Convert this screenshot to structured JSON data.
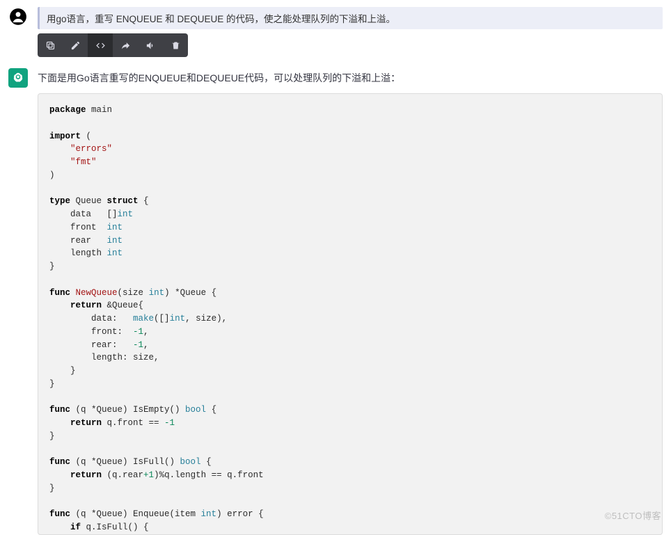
{
  "user": {
    "text": "用go语言，重写 ENQUEUE 和 DEQUEUE 的代码，使之能处理队列的下溢和上溢。"
  },
  "toolbar": {
    "copy": "copy",
    "edit": "edit",
    "code": "code",
    "share": "share",
    "volume": "volume",
    "delete": "delete"
  },
  "assistant": {
    "intro": "下面是用Go语言重写的ENQUEUE和DEQUEUE代码，可以处理队列的下溢和上溢：",
    "code": {
      "l1a": "package",
      "l1b": " main",
      "l3": "import",
      "l3b": " (",
      "l4": "    \"errors\"",
      "l5": "    \"fmt\"",
      "l6": ")",
      "l8a": "type",
      "l8b": " Queue ",
      "l8c": "struct",
      "l8d": " {",
      "l9a": "    data   []",
      "l9b": "int",
      "l10a": "    front  ",
      "l10b": "int",
      "l11a": "    rear   ",
      "l11b": "int",
      "l12a": "    length ",
      "l12b": "int",
      "l13": "}",
      "l15a": "func",
      "l15b": " ",
      "l15c": "NewQueue",
      "l15d": "(size ",
      "l15e": "int",
      "l15f": ") *Queue {",
      "l16a": "    ",
      "l16b": "return",
      "l16c": " &Queue{",
      "l17a": "        data:   ",
      "l17b": "make",
      "l17c": "([]",
      "l17d": "int",
      "l17e": ", size),",
      "l18a": "        front:  ",
      "l18b": "-1",
      "l18c": ",",
      "l19a": "        rear:   ",
      "l19b": "-1",
      "l19c": ",",
      "l20": "        length: size,",
      "l21": "    }",
      "l22": "}",
      "l24a": "func",
      "l24b": " (q *Queue) IsEmpty() ",
      "l24c": "bool",
      "l24d": " {",
      "l25a": "    ",
      "l25b": "return",
      "l25c": " q.front == ",
      "l25d": "-1",
      "l26": "}",
      "l28a": "func",
      "l28b": " (q *Queue) IsFull() ",
      "l28c": "bool",
      "l28d": " {",
      "l29a": "    ",
      "l29b": "return",
      "l29c": " (q.rear",
      "l29d": "+1",
      "l29e": ")%q.length == q.front",
      "l30": "}",
      "l32a": "func",
      "l32b": " (q *Queue) Enqueue(item ",
      "l32c": "int",
      "l32d": ") error {",
      "l33a": "    ",
      "l33b": "if",
      "l33c": " q.IsFull() {"
    }
  },
  "watermark": "©51CTO博客"
}
